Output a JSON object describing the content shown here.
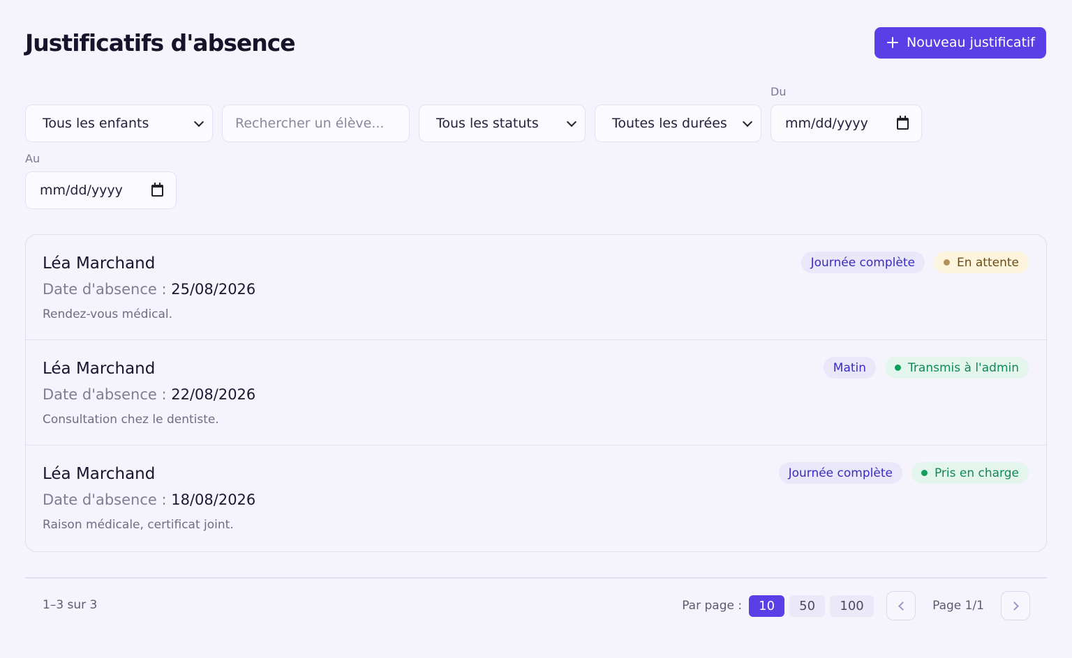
{
  "header": {
    "title": "Justificatifs d'absence",
    "new_button_label": "Nouveau justificatif"
  },
  "filters": {
    "child_select": "Tous les enfants",
    "search_placeholder": "Rechercher un élève...",
    "status_select": "Tous les statuts",
    "duration_select": "Toutes les durées",
    "from_label": "Du",
    "from_value": "mm/dd/yyyy",
    "to_label": "Au",
    "to_value": "mm/dd/yyyy"
  },
  "absence_prefix": "Date d'absence : ",
  "records": [
    {
      "student": "Léa Marchand",
      "date": "25/08/2026",
      "reason": "Rendez-vous médical.",
      "duration": "Journée complète",
      "status": "En attente"
    },
    {
      "student": "Léa Marchand",
      "date": "22/08/2026",
      "reason": "Consultation chez le dentiste.",
      "duration": "Matin",
      "status": "Transmis à l'admin"
    },
    {
      "student": "Léa Marchand",
      "date": "18/08/2026",
      "reason": "Raison médicale, certificat joint.",
      "duration": "Journée complète",
      "status": "Pris en charge"
    }
  ],
  "pagination": {
    "count": "1–3 sur 3",
    "per_page_label": "Par page :",
    "options": [
      "10",
      "50",
      "100"
    ],
    "selected": "10",
    "page_info": "Page 1/1"
  },
  "colors": {
    "accent": "#5a3ee6",
    "pending": "#b2905a",
    "success": "#0f9e5c"
  }
}
